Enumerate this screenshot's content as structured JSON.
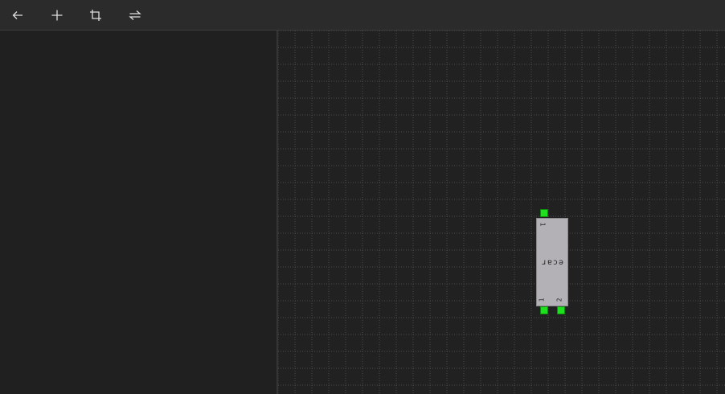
{
  "toolbar": {
    "buttons": [
      {
        "name": "back",
        "icon": "arrow-left-icon"
      },
      {
        "name": "add",
        "icon": "plus-icon"
      },
      {
        "name": "crop",
        "icon": "crop-icon"
      },
      {
        "name": "swap",
        "icon": "swap-arrows-icon"
      }
    ]
  },
  "canvas": {
    "grid": true,
    "component": {
      "name": "ecar",
      "pins": [
        {
          "label": "1",
          "side": "top"
        },
        {
          "label": "1",
          "side": "bottom"
        },
        {
          "label": "2",
          "side": "bottom"
        }
      ]
    }
  },
  "colors": {
    "background": "#202020",
    "toolbar": "#2b2b2b",
    "grid_line": "#4a4a4a",
    "component_fill": "#b3b1b5",
    "pin": "#1ee01e"
  }
}
